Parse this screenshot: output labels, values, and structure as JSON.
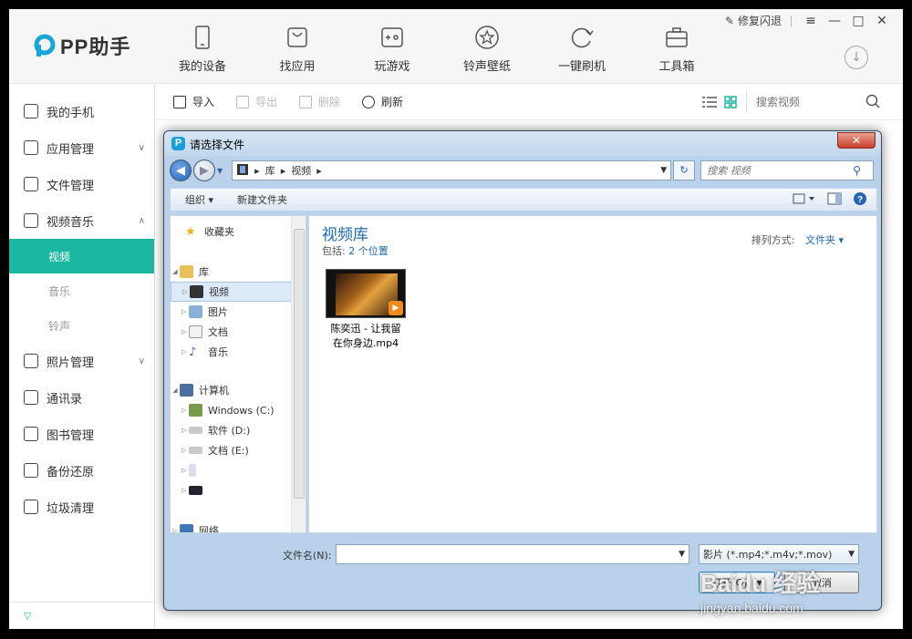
{
  "app": {
    "logo_text": "PP助手",
    "nav": [
      {
        "label": "我的设备",
        "icon": "phone-icon"
      },
      {
        "label": "找应用",
        "icon": "bag-icon"
      },
      {
        "label": "玩游戏",
        "icon": "gamepad-icon"
      },
      {
        "label": "铃声壁纸",
        "icon": "star-icon"
      },
      {
        "label": "一键刷机",
        "icon": "refresh-circle-icon"
      },
      {
        "label": "工具箱",
        "icon": "toolbox-icon"
      }
    ],
    "window": {
      "repair_label": "修复闪退",
      "menu": "≡",
      "minimize": "—",
      "maximize": "□",
      "close": "✕"
    },
    "download_icon": "↓"
  },
  "sidebar": {
    "items": [
      {
        "label": "我的手机"
      },
      {
        "label": "应用管理",
        "arrow": "∨"
      },
      {
        "label": "文件管理"
      },
      {
        "label": "视频音乐",
        "arrow": "∧"
      }
    ],
    "subitems": [
      {
        "label": "视频",
        "active": true
      },
      {
        "label": "音乐"
      },
      {
        "label": "铃声"
      }
    ],
    "items2": [
      {
        "label": "照片管理",
        "arrow": "∨"
      },
      {
        "label": "通讯录"
      },
      {
        "label": "图书管理"
      },
      {
        "label": "备份还原"
      },
      {
        "label": "垃圾清理"
      }
    ],
    "bottom_icon": "▽"
  },
  "toolbar": {
    "import": "导入",
    "export": "导出",
    "delete": "删除",
    "refresh": "刷新",
    "search_placeholder": "搜索视频"
  },
  "dialog": {
    "title": "请选择文件",
    "close": "✕",
    "pp_mark": "P",
    "address": {
      "segments": [
        "库",
        "视频"
      ]
    },
    "search_placeholder": "搜索 视频",
    "commands": {
      "organize": "组织 ▾",
      "new_folder": "新建文件夹"
    },
    "nav_pane": {
      "favorites": "收藏夹",
      "libraries": "库",
      "lib_items": [
        "视频",
        "图片",
        "文档",
        "音乐"
      ],
      "computer": "计算机",
      "drives": [
        "Windows (C:)",
        "软件 (D:)",
        "文档 (E:)"
      ],
      "network": "网络"
    },
    "library": {
      "title": "视频库",
      "includes_label": "包括:",
      "includes_value": "2 个位置",
      "sort_label": "排列方式:",
      "sort_value": "文件夹 ▾"
    },
    "file": {
      "name_line1": "陈奕迅 - 让我留",
      "name_line2": "在你身边.mp4"
    },
    "filename_label": "文件名(N):",
    "filename_value": "",
    "filetype": "影片 (*.mp4;*.m4v;*.mov)",
    "open_button": "打开(O)",
    "cancel_button": "取消"
  },
  "watermark": {
    "line1": "Baidu 经验",
    "line2": "jingyan.baidu.com"
  }
}
